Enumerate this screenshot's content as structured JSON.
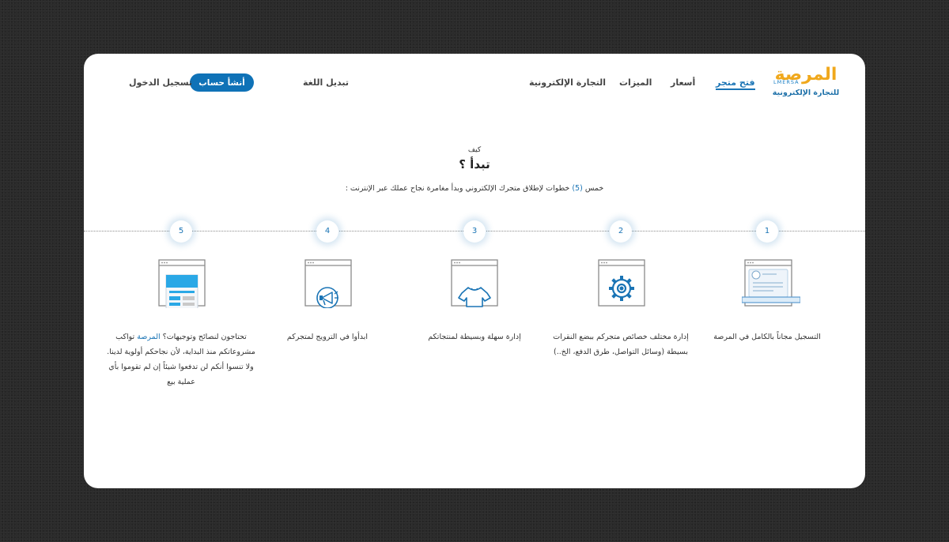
{
  "brand": {
    "name": "المرصة",
    "latin": "LMERSA",
    "tagline": "للتجارة الإلكترونية"
  },
  "nav": {
    "open_store": "فتح متجر",
    "prices": "أسعار",
    "features": "الميزات",
    "ecommerce": "التجارة الإلكترونية",
    "change_language": "تبديل اللغة",
    "signup": "أنشأ حساب",
    "login": "تسجيل الدخول"
  },
  "intro": {
    "small": "كيف",
    "title": "تبدأ ؟",
    "subtitle_before": "خمس ",
    "subtitle_highlight": "(5)",
    "subtitle_after": " خطوات لإطلاق متجرك الإلكتروني وبدأ مغامرة نجاح عملك عبر الإنترنت :"
  },
  "steps": [
    {
      "number": "1",
      "icon": "profile-window-icon",
      "text": "التسجيل مجاناً بالكامل في المرصة"
    },
    {
      "number": "2",
      "icon": "gear-window-icon",
      "text": "إدارة مختلف خصائص متجركم ببضع النقرات بسيطة (وسائل التواصل، طرق الدفع، الخ..)"
    },
    {
      "number": "3",
      "icon": "tshirt-window-icon",
      "text": "إدارة سهلة وبسيطة لمنتجاتكم"
    },
    {
      "number": "4",
      "icon": "megaphone-window-icon",
      "text": "ابدأوا في الترويج لمتجركم"
    },
    {
      "number": "5",
      "icon": "document-window-icon",
      "text_before": "تحتاجون لنصائح وتوجيهات؟ ",
      "text_highlight": "المرصة",
      "text_after": " تواكب مشروعاتكم منذ البداية، لأن نجاحكم أولوية لدينا. ولا تنسوا أنكم لن تدفعوا شيئاً إن لم تقوموا بأي عملية بيع"
    }
  ],
  "colors": {
    "primary": "#0f72b7",
    "brand_orange": "#f0a81c",
    "icon_blue": "#1a74b5",
    "icon_light_blue": "#2aa8e6"
  }
}
